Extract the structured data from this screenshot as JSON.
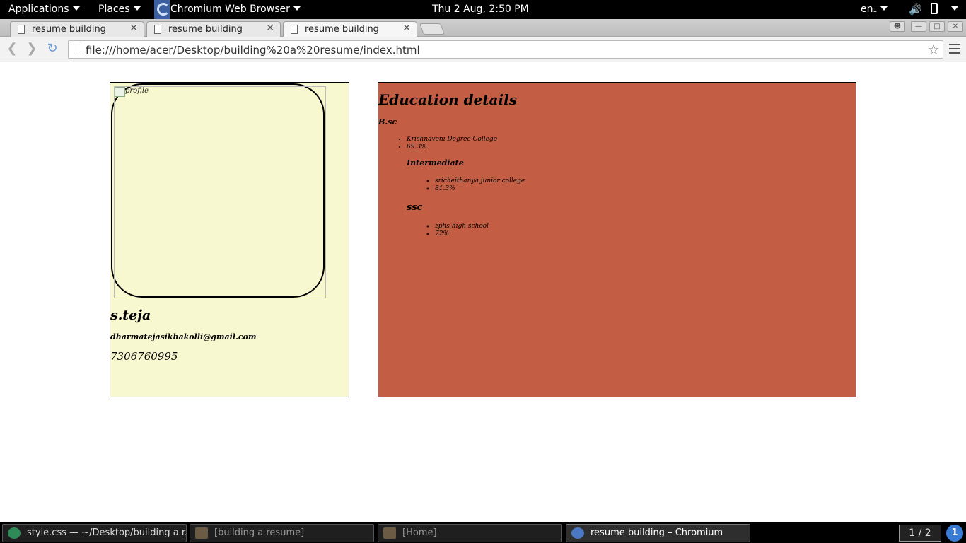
{
  "panel": {
    "applications": "Applications",
    "places": "Places",
    "app_name": "Chromium Web Browser",
    "clock": "Thu  2 Aug,  2:50 PM",
    "keyboard": "en₁"
  },
  "browser": {
    "tabs": [
      {
        "label": "resume building"
      },
      {
        "label": "resume building"
      },
      {
        "label": "resume building"
      }
    ],
    "url": "file:///home/acer/Desktop/building%20a%20resume/index.html"
  },
  "profile": {
    "photo_alt": "profile",
    "name": "s.teja",
    "email": "dharmatejasikhakolli@gmail.com",
    "phone": "7306760995"
  },
  "education": {
    "title": "Education details",
    "bsc": {
      "heading": "B.sc",
      "items": [
        "Krishnaveni Degree College",
        "69.3%"
      ]
    },
    "intermediate": {
      "heading": "Intermediate",
      "items": [
        "sricheithanya junior college",
        "81.3%"
      ]
    },
    "ssc": {
      "heading": "ssc",
      "items": [
        "zphs high school",
        "72%"
      ]
    }
  },
  "taskbar": {
    "tasks": [
      {
        "label": "style.css — ~/Desktop/building a r..."
      },
      {
        "label": "[building a resume]"
      },
      {
        "label": "[Home]"
      },
      {
        "label": "resume building – Chromium"
      }
    ],
    "workspace": "1 / 2",
    "notifications": "1"
  },
  "colors": {
    "profile_bg": "#f7f8d0",
    "education_bg": "#c35e44"
  }
}
